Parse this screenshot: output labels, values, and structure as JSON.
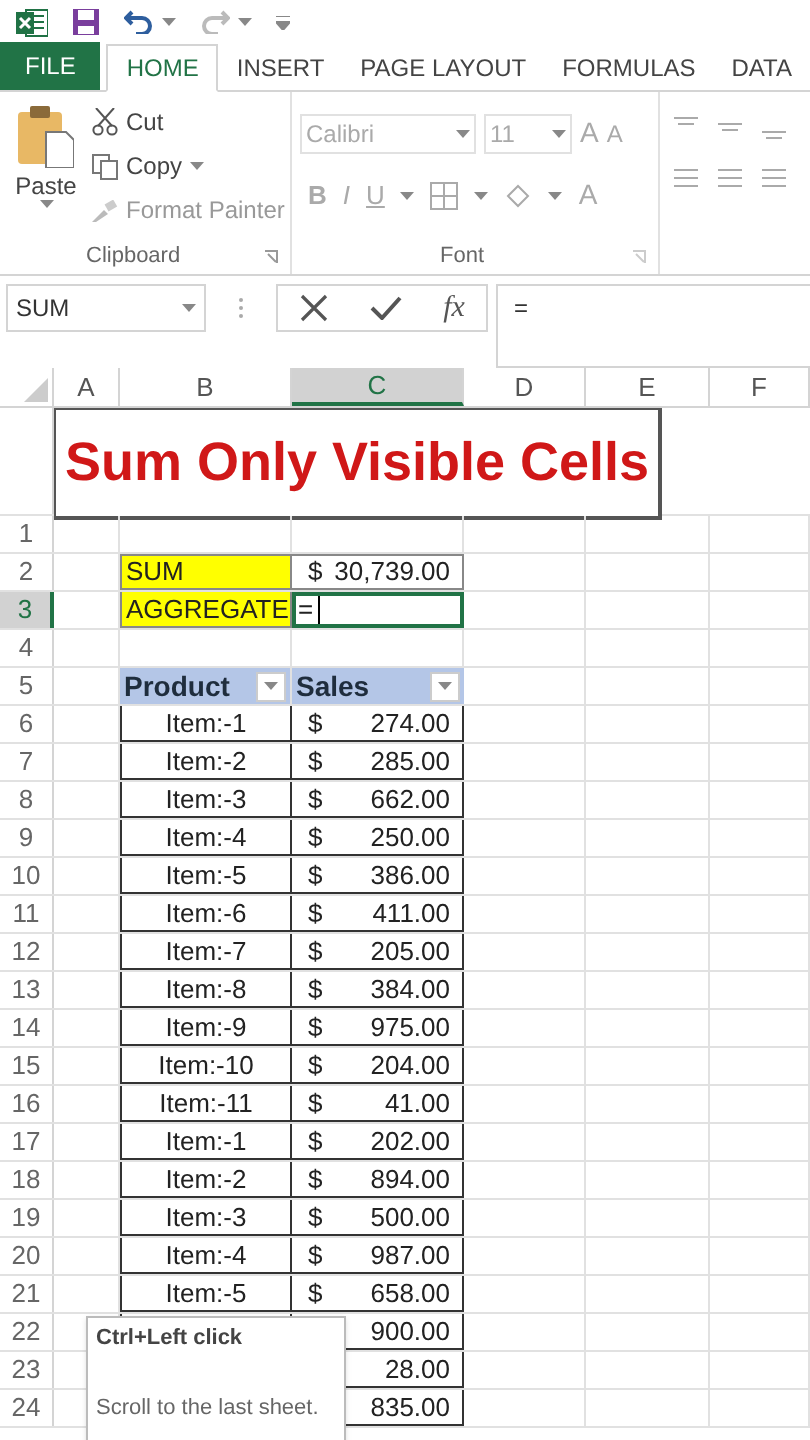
{
  "ribbon_tabs": [
    {
      "label": "FILE",
      "kind": "file",
      "selected": false
    },
    {
      "label": "HOME",
      "kind": "tab",
      "selected": true
    },
    {
      "label": "INSERT",
      "kind": "tab",
      "selected": false
    },
    {
      "label": "PAGE LAYOUT",
      "kind": "tab",
      "selected": false
    },
    {
      "label": "FORMULAS",
      "kind": "tab",
      "selected": false
    },
    {
      "label": "DATA",
      "kind": "tab",
      "selected": false
    }
  ],
  "clipboard": {
    "paste": "Paste",
    "cut": "Cut",
    "copy": "Copy",
    "format_painter": "Format Painter",
    "group_label": "Clipboard"
  },
  "font": {
    "font_name": "Calibri",
    "font_size": "11",
    "grow": "A",
    "shrink": "A",
    "bold": "B",
    "italic": "I",
    "underline": "U",
    "font_color": "A",
    "group_label": "Font"
  },
  "formula_bar": {
    "name_box": "SUM",
    "function_label": "fx",
    "formula": "="
  },
  "columns": [
    {
      "label": "A",
      "selected": false
    },
    {
      "label": "B",
      "selected": false
    },
    {
      "label": "C",
      "selected": true
    },
    {
      "label": "D",
      "selected": false
    },
    {
      "label": "E",
      "selected": false
    },
    {
      "label": "F",
      "selected": false
    }
  ],
  "title": "Sum Only Visible Cells",
  "rows": [
    {
      "number": "1",
      "kind": "blank",
      "selected": false
    },
    {
      "number": "2",
      "kind": "label",
      "selected": false,
      "b": "SUM",
      "currency": "$",
      "amount": "30,739.00"
    },
    {
      "number": "3",
      "kind": "input",
      "selected": true,
      "b": "AGGREGATE",
      "value": "="
    },
    {
      "number": "4",
      "kind": "blank",
      "selected": false
    },
    {
      "number": "5",
      "kind": "header",
      "selected": false,
      "b": "Product",
      "c": "Sales"
    },
    {
      "number": "6",
      "kind": "item",
      "selected": false,
      "b": "Item:-1",
      "currency": "$",
      "amount": "274.00"
    },
    {
      "number": "7",
      "kind": "item",
      "selected": false,
      "b": "Item:-2",
      "currency": "$",
      "amount": "285.00"
    },
    {
      "number": "8",
      "kind": "item",
      "selected": false,
      "b": "Item:-3",
      "currency": "$",
      "amount": "662.00"
    },
    {
      "number": "9",
      "kind": "item",
      "selected": false,
      "b": "Item:-4",
      "currency": "$",
      "amount": "250.00"
    },
    {
      "number": "10",
      "kind": "item",
      "selected": false,
      "b": "Item:-5",
      "currency": "$",
      "amount": "386.00"
    },
    {
      "number": "11",
      "kind": "item",
      "selected": false,
      "b": "Item:-6",
      "currency": "$",
      "amount": "411.00"
    },
    {
      "number": "12",
      "kind": "item",
      "selected": false,
      "b": "Item:-7",
      "currency": "$",
      "amount": "205.00"
    },
    {
      "number": "13",
      "kind": "item",
      "selected": false,
      "b": "Item:-8",
      "currency": "$",
      "amount": "384.00"
    },
    {
      "number": "14",
      "kind": "item",
      "selected": false,
      "b": "Item:-9",
      "currency": "$",
      "amount": "975.00"
    },
    {
      "number": "15",
      "kind": "item",
      "selected": false,
      "b": "Item:-10",
      "currency": "$",
      "amount": "204.00"
    },
    {
      "number": "16",
      "kind": "item",
      "selected": false,
      "b": "Item:-11",
      "currency": "$",
      "amount": "41.00"
    },
    {
      "number": "17",
      "kind": "item",
      "selected": false,
      "b": "Item:-1",
      "currency": "$",
      "amount": "202.00"
    },
    {
      "number": "18",
      "kind": "item",
      "selected": false,
      "b": "Item:-2",
      "currency": "$",
      "amount": "894.00"
    },
    {
      "number": "19",
      "kind": "item",
      "selected": false,
      "b": "Item:-3",
      "currency": "$",
      "amount": "500.00"
    },
    {
      "number": "20",
      "kind": "item",
      "selected": false,
      "b": "Item:-4",
      "currency": "$",
      "amount": "987.00"
    },
    {
      "number": "21",
      "kind": "item",
      "selected": false,
      "b": "Item:-5",
      "currency": "$",
      "amount": "658.00"
    },
    {
      "number": "22",
      "kind": "covered",
      "selected": false,
      "amount": "900.00"
    },
    {
      "number": "23",
      "kind": "covered",
      "selected": false,
      "amount": "28.00"
    },
    {
      "number": "24",
      "kind": "covered",
      "selected": false,
      "amount": "835.00"
    }
  ],
  "tooltip": {
    "title": "Ctrl+Left click",
    "text": "Scroll to the last sheet."
  }
}
